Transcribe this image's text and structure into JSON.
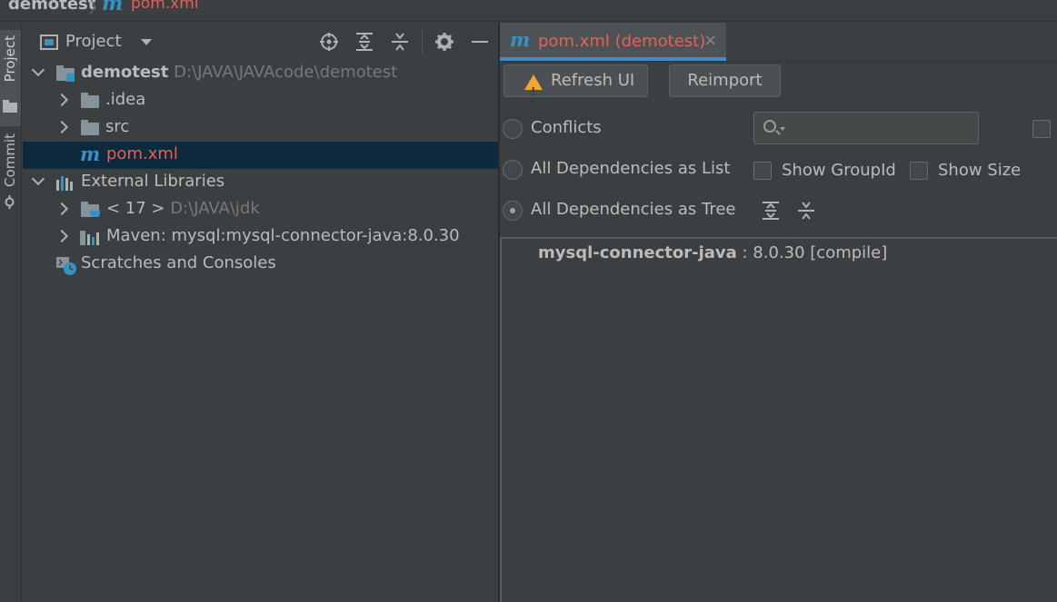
{
  "breadcrumb": {
    "project": "demotest",
    "separator": "〉",
    "file_icon": "m",
    "file": "pom.xml"
  },
  "stripe": {
    "project_label": "Project",
    "commit_label": "Commit"
  },
  "project_panel": {
    "title": "Project",
    "toolbar": [
      "locate-icon",
      "expand-all-icon",
      "collapse-all-icon",
      "gear-icon",
      "minimize-icon"
    ],
    "tree": [
      {
        "label": "demotest",
        "path": "D:\\JAVA\\JAVAcode\\demotest"
      },
      {
        "label": ".idea"
      },
      {
        "label": "src"
      },
      {
        "icon": "m",
        "label": "pom.xml"
      },
      {
        "label": "External Libraries"
      },
      {
        "label": "< 17 >",
        "path": "D:\\JAVA\\jdk"
      },
      {
        "label": "Maven: mysql:mysql-connector-java:8.0.30"
      },
      {
        "label": "Scratches and Consoles"
      }
    ]
  },
  "editor": {
    "tab": {
      "icon": "m",
      "label": "pom.xml (demotest)",
      "close": "×"
    },
    "buttons": {
      "refresh": "Refresh UI",
      "reimport": "Reimport"
    },
    "options": {
      "conflicts": "Conflicts",
      "list": "All Dependencies as List",
      "tree": "All Dependencies as Tree",
      "selected": "All Dependencies as Tree"
    },
    "checkboxes": {
      "group_id": "Show GroupId",
      "size": "Show Size"
    },
    "search": {
      "placeholder": ""
    },
    "dependency": {
      "name": "mysql-connector-java",
      "detail": " : 8.0.30 [compile]"
    }
  },
  "colors": {
    "background": "#3c3f41",
    "selection": "#0d293e",
    "accent": "#3592c4",
    "modified_file": "#e0635a",
    "tab_underline": "#4a88c7"
  }
}
